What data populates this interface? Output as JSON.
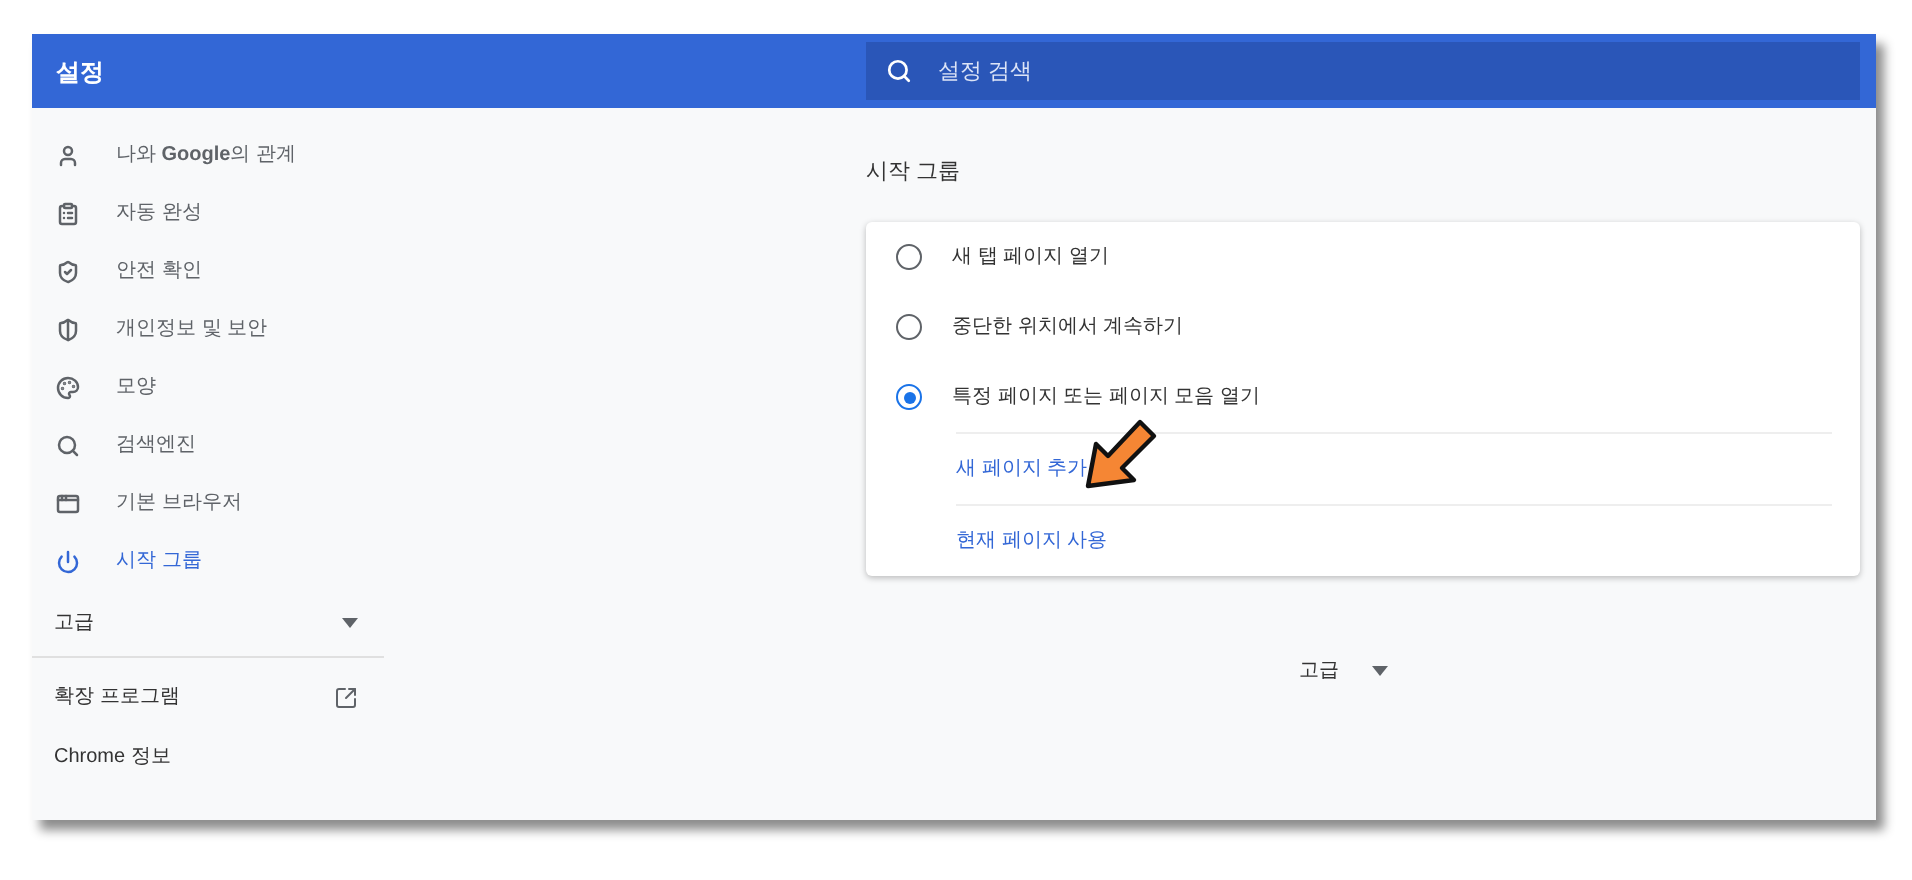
{
  "header": {
    "title": "설정"
  },
  "search": {
    "placeholder": "설정 검색"
  },
  "sidebar": {
    "items": [
      {
        "label": "나와 **Google**의 관계",
        "selected": false
      },
      {
        "label": "자동 완성",
        "selected": false
      },
      {
        "label": "안전 확인",
        "selected": false
      },
      {
        "label": "개인정보 및 보안",
        "selected": false
      },
      {
        "label": "모양",
        "selected": false
      },
      {
        "label": "검색엔진",
        "selected": false
      },
      {
        "label": "기본 브라우저",
        "selected": false
      },
      {
        "label": "시작 그룹",
        "selected": true
      }
    ],
    "advanced": {
      "label": "고급",
      "expanded": false
    },
    "extensions": "확장 프로그램",
    "about": "Chrome 정보"
  },
  "section": {
    "title": "시작 그룹",
    "options": [
      {
        "label": "새 탭 페이지 열기",
        "selected": false
      },
      {
        "label": "중단한 위치에서 계속하기",
        "selected": false
      },
      {
        "label": "특정 페이지 또는 페이지 모음 열기",
        "selected": true
      }
    ],
    "links": [
      "새 페이지 추가",
      "현재 페이지 사용"
    ]
  },
  "advanced": {
    "label": "고급",
    "expanded": false
  }
}
